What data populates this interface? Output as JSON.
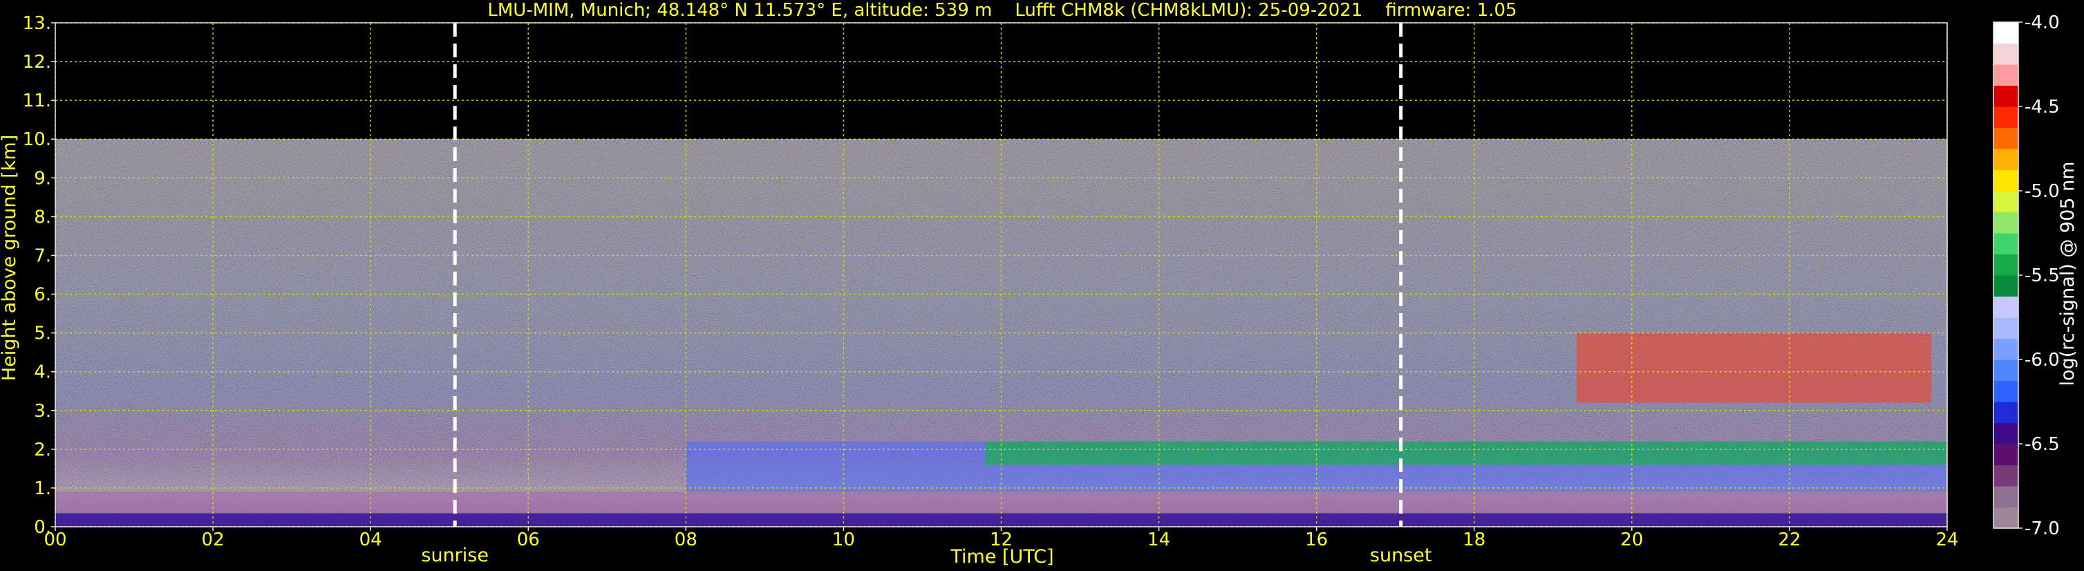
{
  "chart_data": {
    "type": "heatmap",
    "title": "LMU-MIM, Munich; 48.148° N 11.573° E, altitude: 539 m    Lufft CHM8k (CHM8kLMU): 25-09-2021    firmware: 1.05",
    "xlabel": "Time [UTC]",
    "ylabel": "Height above ground [km]",
    "xlim": [
      0,
      24
    ],
    "ylim": [
      0,
      13
    ],
    "x_ticks": [
      "00",
      "02",
      "04",
      "06",
      "08",
      "10",
      "12",
      "14",
      "16",
      "18",
      "20",
      "22",
      "24"
    ],
    "y_ticks": [
      "0.",
      "1.",
      "2.",
      "3.",
      "4.",
      "5.",
      "6.",
      "7.",
      "8.",
      "9.",
      "10.",
      "11.",
      "12.",
      "13."
    ],
    "grid": true,
    "data_top_km": 10,
    "markers": [
      {
        "label": "sunrise",
        "x": 5.07
      },
      {
        "label": "sunset",
        "x": 17.07
      }
    ],
    "colorbar": {
      "label": "log(rc-signal) @ 905 nm",
      "range": [
        -7.0,
        -4.0
      ],
      "ticks": [
        "-4.0",
        "-4.5",
        "-5.0",
        "-5.5",
        "-6.0",
        "-6.5",
        "-7.0"
      ],
      "colors": [
        "#9b8596",
        "#8f6f8f",
        "#7a3a7a",
        "#5b1070",
        "#3f0a8a",
        "#1f2bd6",
        "#2a63ff",
        "#4d86ff",
        "#7aa0ff",
        "#a9b8ff",
        "#c5c9ff",
        "#0a8a3b",
        "#19a84c",
        "#3fd46a",
        "#8fe86a",
        "#d7f53c",
        "#ffe600",
        "#ffb000",
        "#ff6a00",
        "#ff2a00",
        "#d90000",
        "#ff9aa0",
        "#f3d5d8",
        "#ffffff"
      ]
    }
  }
}
